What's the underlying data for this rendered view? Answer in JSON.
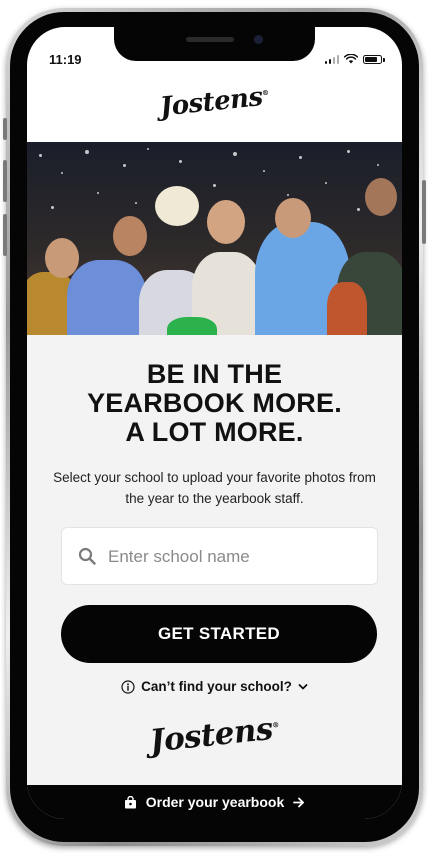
{
  "status_bar": {
    "time": "11:19",
    "icons": [
      "cellular-signal-icon",
      "wifi-icon",
      "battery-icon"
    ]
  },
  "header": {
    "logo_text": "Jostens",
    "logo_mark": "®"
  },
  "hero": {
    "image_semantic": "students-cheering-hero-photo"
  },
  "headline": {
    "lines": [
      "BE IN THE",
      "YEARBOOK MORE.",
      "A LOT MORE."
    ]
  },
  "subtext": "Select your school to upload your favorite photos from the year to the yearbook staff.",
  "search": {
    "placeholder": "Enter school name",
    "value": "",
    "icon": "search-icon"
  },
  "cta": {
    "label": "GET STARTED"
  },
  "help_link": {
    "label": "Can’t find your school?",
    "icon": "info-icon",
    "chevron": "chevron-down-icon"
  },
  "footer_logo": {
    "logo_text": "Jostens",
    "logo_mark": "®"
  },
  "footer_bar": {
    "label": "Order your yearbook",
    "icon": "shopping-bag-icon",
    "arrow": "arrow-right-icon"
  },
  "colors": {
    "primary": "#050505",
    "background": "#f3f3f3",
    "text": "#111111",
    "placeholder": "#8a8a8a",
    "button_text": "#ffffff"
  }
}
